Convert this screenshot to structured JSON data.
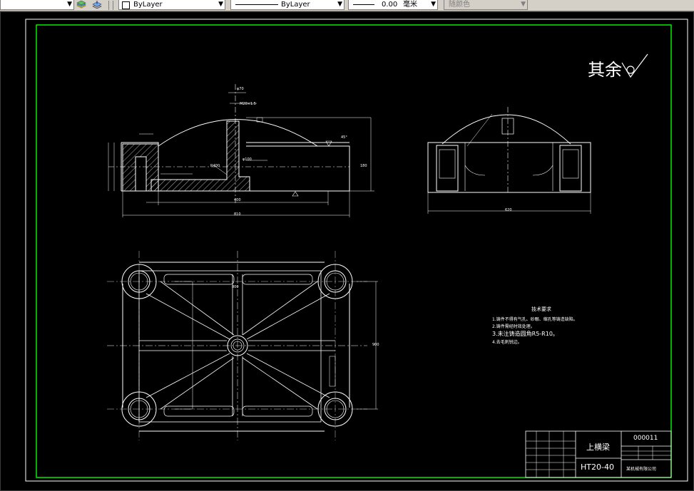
{
  "toolbar": {
    "color_combo": "ByLayer",
    "linetype_combo": "ByLayer",
    "lineweight_value": "0.00",
    "lineweight_unit": "毫米",
    "plotstyle_combo": "随颜色"
  },
  "drawing": {
    "surface_finish_note": "其余",
    "tech_title": "技术要求",
    "tech_requirements": [
      "1.铸件不得有气孔、砂眼、缩孔等铸造缺陷。",
      "2.铸件需经时效处理。",
      "3.未注铸造圆角R5-R10。",
      "4.去毛刺锐边。"
    ],
    "dimensions": {
      "width_front": "810",
      "inner_front": "400",
      "width_side": "620",
      "dia_70": "φ70",
      "dia_100": "φ100",
      "thread": "M20×1.5",
      "height_right": "180",
      "top_view_height": "900",
      "top_view_width": "800",
      "radius_top": "R400",
      "angle_note": "45°"
    },
    "title_block": {
      "part_name": "上横梁",
      "drawing_no": "000011",
      "material": "HT20-40",
      "company": "某机械有限公司"
    }
  }
}
